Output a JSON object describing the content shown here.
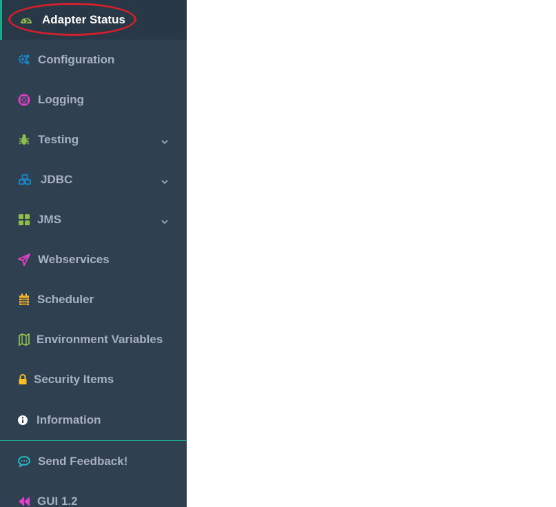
{
  "sidebar": {
    "items": [
      {
        "label": "Adapter Status",
        "icon": "dashboard-icon",
        "color": "#8fbf4a",
        "active": true
      },
      {
        "label": "Configuration",
        "icon": "cogs-icon",
        "color": "#1c84c6"
      },
      {
        "label": "Logging",
        "icon": "lifebuoy-icon",
        "color": "#e040c8"
      },
      {
        "label": "Testing",
        "icon": "bug-icon",
        "color": "#8fbf4a",
        "expandable": true
      },
      {
        "label": "JDBC",
        "icon": "cubes-icon",
        "color": "#1c84c6",
        "expandable": true
      },
      {
        "label": "JMS",
        "icon": "grid-icon",
        "color": "#8fbf4a",
        "expandable": true
      },
      {
        "label": "Webservices",
        "icon": "paper-plane-icon",
        "color": "#e040c8"
      },
      {
        "label": "Scheduler",
        "icon": "calendar-icon",
        "color": "#f0b429"
      },
      {
        "label": "Environment Variables",
        "icon": "map-icon",
        "color": "#8fbf4a"
      },
      {
        "label": "Security Items",
        "icon": "lock-icon",
        "color": "#f8c020"
      },
      {
        "label": "Information",
        "icon": "info-icon",
        "color": "#ffffff"
      }
    ],
    "footer": [
      {
        "label": "Send Feedback!",
        "icon": "chat-icon",
        "color": "#23c6c8"
      },
      {
        "label": "GUI 1.2",
        "icon": "backward-icon",
        "color": "#e040c8"
      }
    ]
  },
  "colors": {
    "sidebar_bg": "#2f4050",
    "active_bg": "#293846",
    "accent": "#19aa8d",
    "highlight": "#d0202c"
  }
}
